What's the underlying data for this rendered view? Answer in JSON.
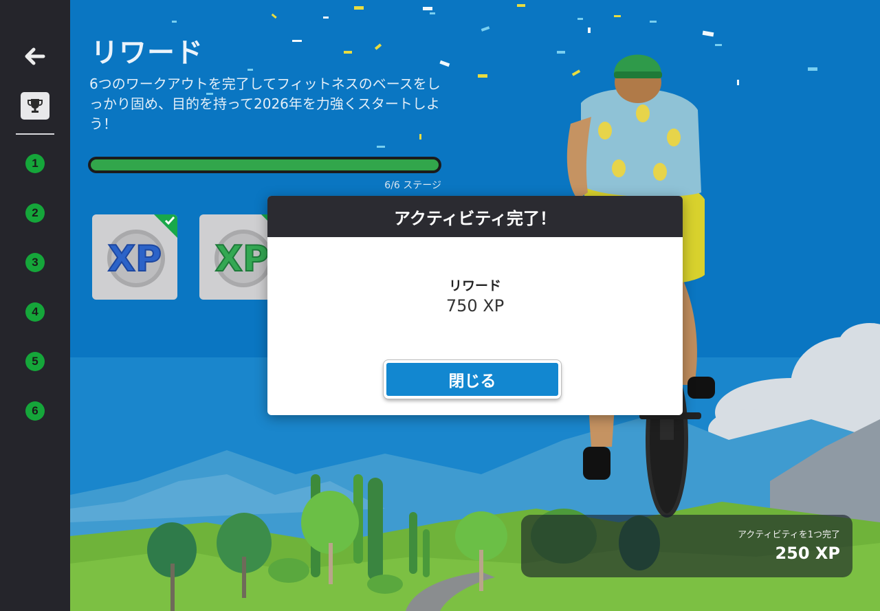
{
  "sidebar": {
    "back_icon": "arrow-left-icon",
    "trophy_icon": "trophy-icon",
    "stages": [
      "1",
      "2",
      "3",
      "4",
      "5",
      "6"
    ]
  },
  "header": {
    "title": "リワード",
    "description": "6つのワークアウトを完了してフィットネスのベースをしっかり固め、目的を持って2026年を力強くスタートしよう！"
  },
  "progress": {
    "completed": 6,
    "total": 6,
    "label": "6/6 ステージ"
  },
  "badges": [
    {
      "icon": "xp-blue-badge-icon",
      "completed": true
    },
    {
      "icon": "xp-green-badge-icon",
      "completed": true
    }
  ],
  "modal": {
    "title": "アクティビティ完了！",
    "reward_label": "リワード",
    "reward_value": "750 XP",
    "close_label": "閉じる"
  },
  "toast": {
    "label": "アクティビティを1つ完了",
    "value": "250 XP"
  },
  "colors": {
    "sky": "#0a76c2",
    "sidebar": "#25252b",
    "stage_green": "#15a63a",
    "progress_green": "#32a64b",
    "button_blue": "#1287d0"
  }
}
